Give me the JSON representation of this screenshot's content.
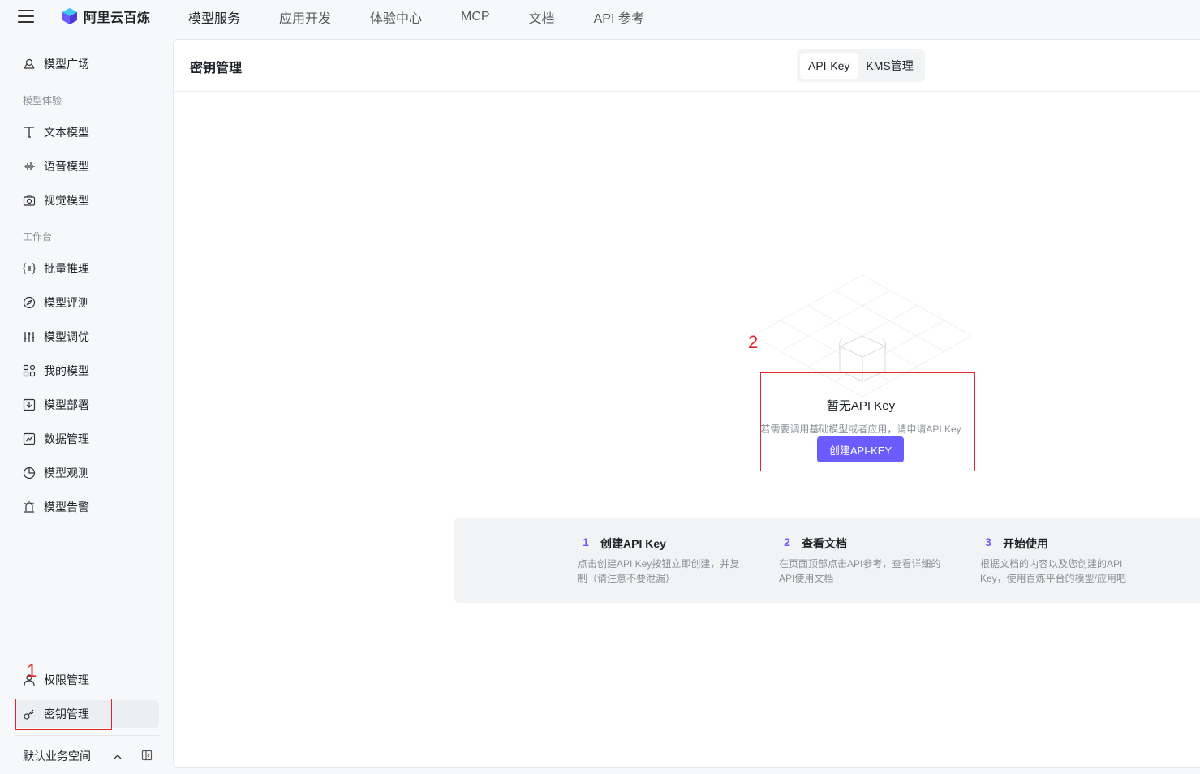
{
  "app": {
    "logo_text": "阿里云百炼"
  },
  "topnav": [
    "模型服务",
    "应用开发",
    "体验中心",
    "MCP",
    "文档",
    "API 参考"
  ],
  "sidebar": {
    "model_square": "模型广场",
    "group_experience": "模型体验",
    "text_model": "文本模型",
    "voice_model": "语音模型",
    "vision_model": "视觉模型",
    "group_workbench": "工作台",
    "batch_inference": "批量推理",
    "model_eval": "模型评测",
    "model_tuning": "模型调优",
    "my_models": "我的模型",
    "model_deploy": "模型部署",
    "data_manage": "数据管理",
    "model_observe": "模型观测",
    "model_alert": "模型告警",
    "permission_manage": "权限管理",
    "key_manage": "密钥管理",
    "workspace": "默认业务空间"
  },
  "main": {
    "title": "密钥管理",
    "tabs": [
      "API-Key",
      "KMS管理"
    ],
    "empty": {
      "title": "暂无API Key",
      "desc": "若需要调用基础模型或者应用，请申请API Key",
      "button": "创建API-KEY"
    },
    "steps": [
      {
        "num": "1",
        "title": "创建API Key",
        "desc": "点击创建API Key按钮立即创建，并复制（请注意不要泄漏）"
      },
      {
        "num": "2",
        "title": "查看文档",
        "desc": "在页面顶部点击API参考，查看详细的API使用文档"
      },
      {
        "num": "3",
        "title": "开始使用",
        "desc": "根据文档的内容以及您创建的API Key，使用百炼平台的模型/应用吧"
      }
    ]
  },
  "annotations": {
    "one": "1",
    "two": "2"
  },
  "colors": {
    "accent": "#6b5cff",
    "annotation": "#e0272e"
  }
}
